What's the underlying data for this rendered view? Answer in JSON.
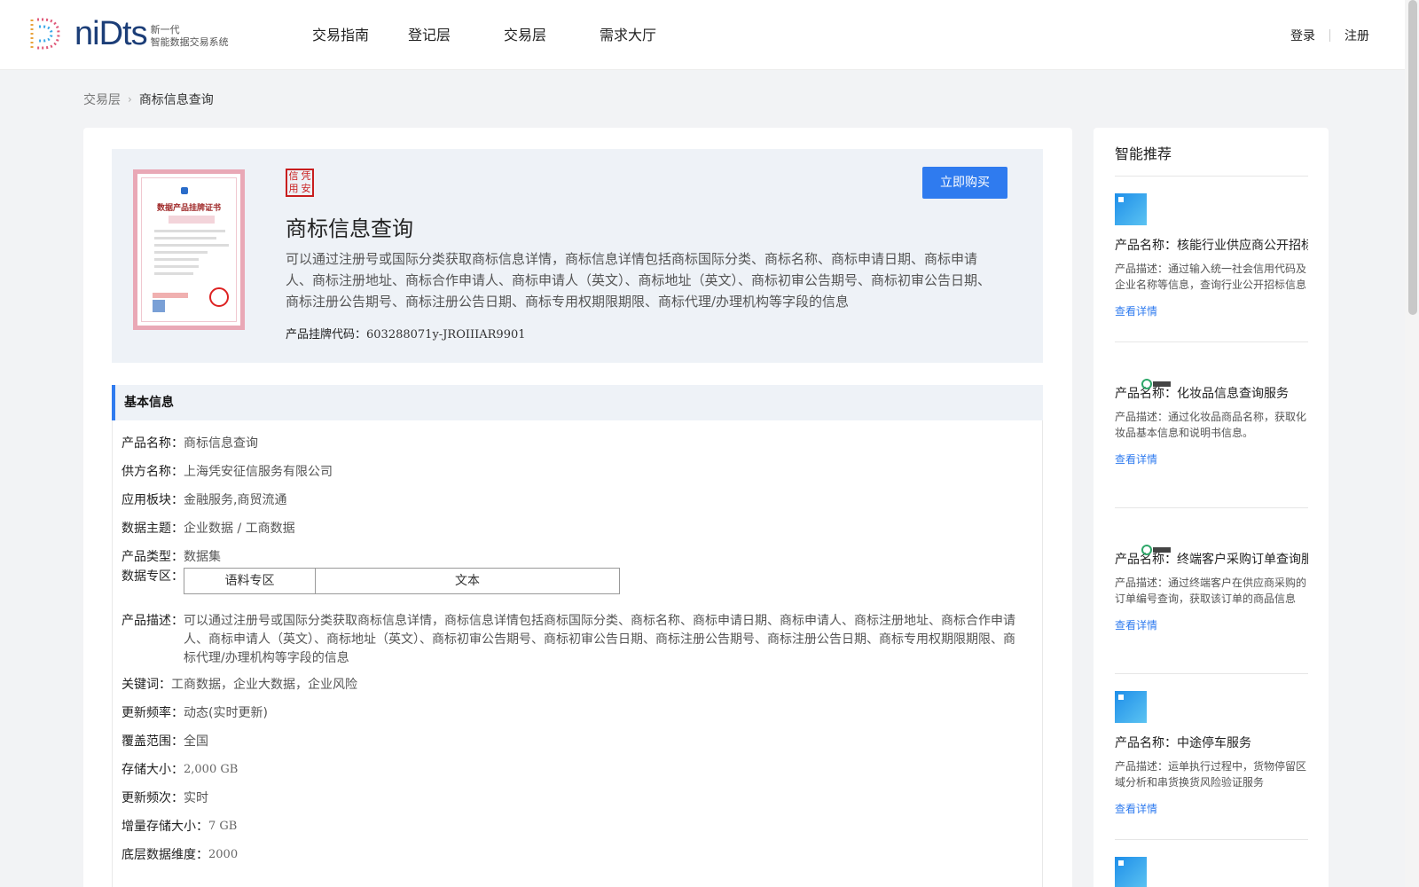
{
  "header": {
    "logo_word": "niDts",
    "logo_sub_line1": "新一代",
    "logo_sub_line2": "智能数据交易系统",
    "nav": [
      "交易指南",
      "登记层",
      "交易层",
      "需求大厅"
    ],
    "login": "登录",
    "register": "注册"
  },
  "breadcrumb": {
    "parent": "交易层",
    "current": "商标信息查询"
  },
  "product": {
    "stamp_chars": [
      "信",
      "凭",
      "用",
      "安"
    ],
    "cert_title": "数据产品挂牌证书",
    "title": "商标信息查询",
    "description": "可以通过注册号或国际分类获取商标信息详情，商标信息详情包括商标国际分类、商标名称、商标申请日期、商标申请人、商标注册地址、商标合作申请人、商标申请人（英文）、商标地址（英文）、商标初审公告期号、商标初审公告日期、商标注册公告期号、商标注册公告日期、商标专用权期限期限、商标代理/办理机构等字段的信息",
    "code_label": "产品挂牌代码：",
    "code_value": "603288071y-JROIIIAR9901",
    "buy_button": "立即购买"
  },
  "basic_info": {
    "section_title": "基本信息",
    "rows": {
      "name": {
        "k": "产品名称：",
        "v": "商标信息查询"
      },
      "supplier": {
        "k": "供方名称：",
        "v": "上海凭安征信服务有限公司"
      },
      "sector": {
        "k": "应用板块：",
        "v": "金融服务,商贸流通"
      },
      "topic": {
        "k": "数据主题：",
        "v": "企业数据 / 工商数据"
      },
      "type": {
        "k": "产品类型：",
        "v": "数据集"
      },
      "zone": {
        "k": "数据专区：",
        "c1": "语料专区",
        "c2": "文本"
      },
      "desc": {
        "k": "产品描述：",
        "v": "可以通过注册号或国际分类获取商标信息详情，商标信息详情包括商标国际分类、商标名称、商标申请日期、商标申请人、商标注册地址、商标合作申请人、商标申请人（英文）、商标地址（英文）、商标初审公告期号、商标初审公告日期、商标注册公告期号、商标注册公告日期、商标专用权期限期限、商标代理/办理机构等字段的信息"
      },
      "keywords": {
        "k": "关键词：",
        "v": "工商数据，企业大数据，企业风险"
      },
      "frequency": {
        "k": "更新频率：",
        "v": "动态(实时更新)"
      },
      "coverage": {
        "k": "覆盖范围：",
        "v": "全国"
      },
      "storage": {
        "k": "存储大小：",
        "v": "2,000 GB"
      },
      "update_times": {
        "k": "更新频次：",
        "v": "实时"
      },
      "increment": {
        "k": "增量存储大小：",
        "v": "7 GB"
      },
      "dimension": {
        "k": "底层数据维度：",
        "v": "2000"
      }
    }
  },
  "sidebar": {
    "title": "智能推荐",
    "items": [
      {
        "name": "产品名称：核能行业供应商公开招标",
        "desc": "产品描述：通过输入统一社会信用代码及企业名称等信息，查询行业公开招标信息",
        "more": "查看详情",
        "img": "blue"
      },
      {
        "name": "产品名称：化妆品信息查询服务",
        "desc": "产品描述：通过化妆品商品名称，获取化妆品基本信息和说明书信息。",
        "more": "查看详情",
        "img": "logo"
      },
      {
        "name": "产品名称：终端客户采购订单查询服务",
        "desc": "产品描述：通过终端客户在供应商采购的订单编号查询，获取该订单的商品信息",
        "more": "查看详情",
        "img": "logo"
      },
      {
        "name": "产品名称：中途停车服务",
        "desc": "产品描述：运单执行过程中，货物停留区域分析和串货换货风险验证服务",
        "more": "查看详情",
        "img": "blue"
      }
    ]
  }
}
